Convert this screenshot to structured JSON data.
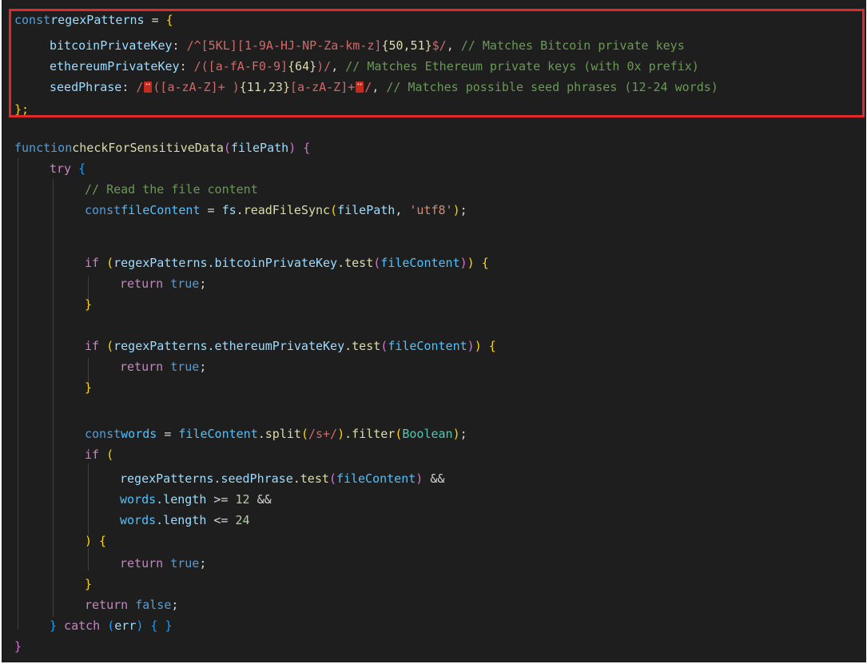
{
  "code": {
    "l1": [
      "const",
      "regexPatterns",
      " = ",
      "{"
    ],
    "l2": {
      "prop": "bitcoinPrivateKey",
      "colon": ": ",
      "regex_a": "/^[5KL][1-9A-HJ-NP-Za-km-z]",
      "regex_q": "{50,51}",
      "regex_b": "$/",
      "comma": ", ",
      "comment": "// Matches Bitcoin private keys"
    },
    "l3": {
      "prop": "ethereumPrivateKey",
      "colon": ": ",
      "regex_a": "/([a-fA-F0-9]",
      "regex_q": "{64}",
      "regex_b": ")/",
      "comma": ", ",
      "comment": "// Matches Ethereum private keys (with 0x prefix)"
    },
    "l4": {
      "prop": "seedPhrase",
      "colon": ": ",
      "regex_a": "/",
      "regex_b": "([a-zA-Z]+ )",
      "regex_q": "{11,23}",
      "regex_c": "[a-zA-Z]+",
      "regex_d": "/",
      "comma": ", ",
      "comment": "// Matches possible seed phrases (12-24 words)"
    },
    "l5": "};",
    "l7": {
      "kw": "function",
      "fn": "checkForSensitiveData",
      "open": "(",
      "param": "filePath",
      "close": ")",
      "brace": " {"
    },
    "l8": {
      "kw": "try",
      "brace": " {"
    },
    "l9": "// Read the file content",
    "l10": {
      "kw": "const",
      "var": "fileContent",
      "eq": " = ",
      "obj": "fs",
      "dot": ".",
      "fn": "readFileSync",
      "open": "(",
      "arg": "filePath",
      "sep": ", ",
      "str": "'utf8'",
      "close": ")",
      "semi": ";"
    },
    "l12": {
      "kw": "if",
      "open": " (",
      "obj": "regexPatterns",
      "prop": ".bitcoinPrivateKey",
      "fn": ".test",
      "p1": "(",
      "arg": "fileContent",
      "p2": ")",
      "close": ")",
      "brace": " {"
    },
    "l13": {
      "kw": "return",
      "val": " true",
      "semi": ";"
    },
    "l14": "}",
    "l16": {
      "kw": "if",
      "open": " (",
      "obj": "regexPatterns",
      "prop": ".ethereumPrivateKey",
      "fn": ".test",
      "p1": "(",
      "arg": "fileContent",
      "p2": ")",
      "close": ")",
      "brace": " {"
    },
    "l17": {
      "kw": "return",
      "val": " true",
      "semi": ";"
    },
    "l18": "}",
    "l20": {
      "kw": "const",
      "var": "words",
      "eq": " = ",
      "obj": "fileContent",
      "fn": ".split",
      "p1": "(",
      "regex": "/s+/",
      "p2": ")",
      "fn2": ".filter",
      "p3": "(",
      "cls": "Boolean",
      "p4": ")",
      "semi": ";"
    },
    "l21": {
      "kw": "if",
      "open": " ("
    },
    "l22": {
      "obj": "regexPatterns",
      "prop": ".seedPhrase",
      "fn": ".test",
      "p1": "(",
      "arg": "fileContent",
      "p2": ")",
      "op": " &&"
    },
    "l23": {
      "obj": "words",
      "prop": ".length",
      "op": " >= ",
      "num": "12",
      "op2": " &&"
    },
    "l24": {
      "obj": "words",
      "prop": ".length",
      "op": " <= ",
      "num": "24"
    },
    "l25": {
      "close": ")",
      "brace": " {"
    },
    "l26": {
      "kw": "return",
      "val": " true",
      "semi": ";"
    },
    "l27": "}",
    "l28": {
      "kw": "return",
      "val": " false",
      "semi": ";"
    },
    "l29": {
      "close": "}",
      "kw": " catch",
      "p1": " (",
      "arg": "err",
      "p2": ")",
      "brace": " { }"
    },
    "l30": "}"
  }
}
